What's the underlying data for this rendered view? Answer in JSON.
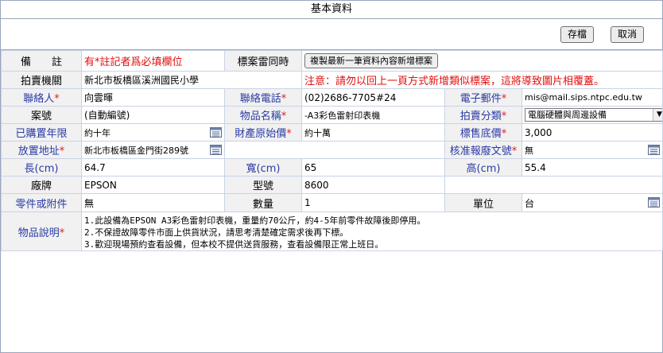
{
  "title": "基本資料",
  "toolbar": {
    "save_label": "存檔",
    "cancel_label": "取消"
  },
  "note": {
    "label": "備　　註",
    "value": "有*註記者爲必填欄位"
  },
  "sync": {
    "label": "標案雷同時",
    "copy_button": "複製最新一筆資料內容新增標案"
  },
  "agency": {
    "label": "拍賣機關",
    "value": "新北市板橋區溪洲國民小學",
    "warning": "注意：請勿以回上一頁方式新增類似標案，這將導致圖片相覆蓋。"
  },
  "contact": {
    "label": "聯絡人",
    "value": "向雲暉"
  },
  "phone": {
    "label": "聯絡電話",
    "value": "(02)2686-7705#24"
  },
  "email": {
    "label": "電子郵件",
    "value": "mis@mail.sips.ntpc.edu.tw"
  },
  "case_no": {
    "label": "案號",
    "value": "(自動編號)"
  },
  "item_name": {
    "label": "物品名稱",
    "value": "-A3彩色雷射印表機"
  },
  "category": {
    "label": "拍賣分類",
    "value": "電腦硬體與周邊設備"
  },
  "years": {
    "label": "已購置年限",
    "value": "約十年"
  },
  "orig_price": {
    "label": "財產原始價",
    "value": "約十萬"
  },
  "base_price": {
    "label": "標售底價",
    "value": "3,000"
  },
  "location": {
    "label": "放置地址",
    "value": "新北市板橋區金門街289號"
  },
  "approval": {
    "label": "核准報廢文號",
    "value": "無"
  },
  "length": {
    "label": "長(cm)",
    "value": "64.7"
  },
  "width": {
    "label": "寬(cm)",
    "value": "65"
  },
  "height": {
    "label": "高(cm)",
    "value": "55.4"
  },
  "brand": {
    "label": "廠牌",
    "value": "EPSON"
  },
  "model": {
    "label": "型號",
    "value": "8600"
  },
  "parts": {
    "label": "零件或附件",
    "value": "無"
  },
  "quantity": {
    "label": "數量",
    "value": "1"
  },
  "unit": {
    "label": "單位",
    "value": "台"
  },
  "description": {
    "label": "物品說明",
    "lines": [
      "1.此設備為EPSON A3彩色雷射印表機，重量約70公斤，約4-5年前零件故障後即停用。",
      "2.不保證故障零件市面上供貨狀況，請思考清楚確定需求後再下標。",
      "3.歡迎現場預約查看設備，但本校不提供送貨服務，查看設備限正常上班日。"
    ]
  },
  "icons": {
    "picker": "picker-icon",
    "dropdown": "chevron-down-icon"
  },
  "colors": {
    "label_blue": "#2a3aa5",
    "required_red": "#e02020",
    "border": "#c9d3e6"
  }
}
